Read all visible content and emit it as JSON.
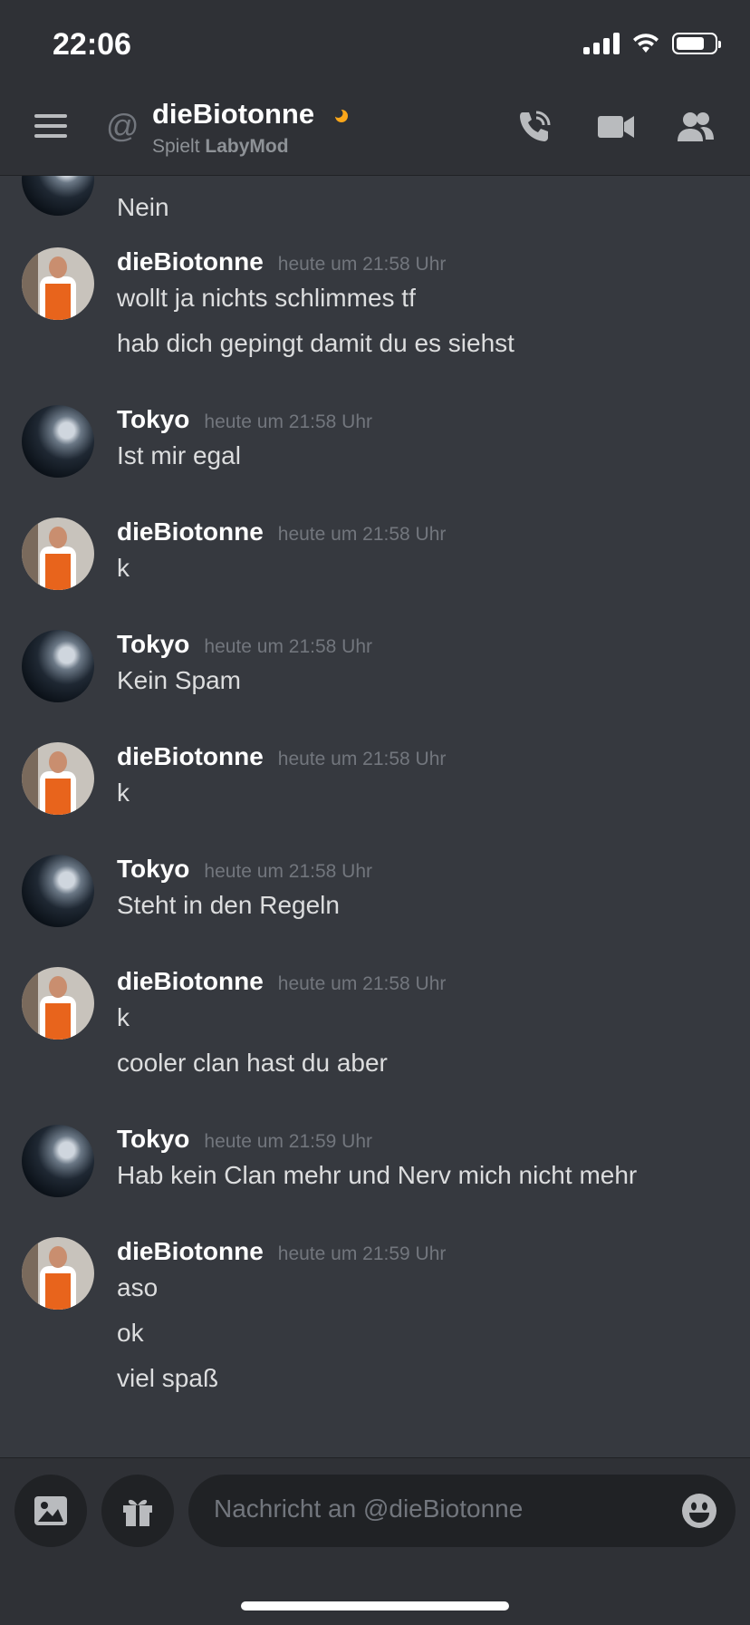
{
  "status_bar": {
    "time": "22:06"
  },
  "header": {
    "channel_name": "dieBiotonne",
    "activity_prefix": "Spielt",
    "activity_game": "LabyMod"
  },
  "messages": [
    {
      "author": "",
      "timestamp": "",
      "lines": [
        "Nein"
      ],
      "avatar": "tokyo"
    },
    {
      "author": "dieBiotonne",
      "timestamp": "heute um 21:58 Uhr",
      "lines": [
        "wollt ja nichts schlimmes tf",
        "hab dich gepingt damit du es siehst"
      ],
      "avatar": "bio"
    },
    {
      "author": "Tokyo",
      "timestamp": "heute um 21:58 Uhr",
      "lines": [
        "Ist mir egal"
      ],
      "avatar": "tokyo"
    },
    {
      "author": "dieBiotonne",
      "timestamp": "heute um 21:58 Uhr",
      "lines": [
        "k"
      ],
      "avatar": "bio"
    },
    {
      "author": "Tokyo",
      "timestamp": "heute um 21:58 Uhr",
      "lines": [
        "Kein Spam"
      ],
      "avatar": "tokyo"
    },
    {
      "author": "dieBiotonne",
      "timestamp": "heute um 21:58 Uhr",
      "lines": [
        "k"
      ],
      "avatar": "bio"
    },
    {
      "author": "Tokyo",
      "timestamp": "heute um 21:58 Uhr",
      "lines": [
        "Steht in den Regeln"
      ],
      "avatar": "tokyo"
    },
    {
      "author": "dieBiotonne",
      "timestamp": "heute um 21:58 Uhr",
      "lines": [
        "k",
        "cooler clan hast du aber"
      ],
      "avatar": "bio"
    },
    {
      "author": "Tokyo",
      "timestamp": "heute um 21:59 Uhr",
      "lines": [
        "Hab kein Clan mehr und Nerv mich nicht mehr"
      ],
      "avatar": "tokyo"
    },
    {
      "author": "dieBiotonne",
      "timestamp": "heute um 21:59 Uhr",
      "lines": [
        "aso",
        "ok",
        "viel spaß"
      ],
      "avatar": "bio"
    }
  ],
  "composer": {
    "placeholder": "Nachricht an @dieBiotonne"
  },
  "colors": {
    "background": "#36393f",
    "header": "#2f3136",
    "input": "#202225",
    "idle": "#faa61a"
  }
}
